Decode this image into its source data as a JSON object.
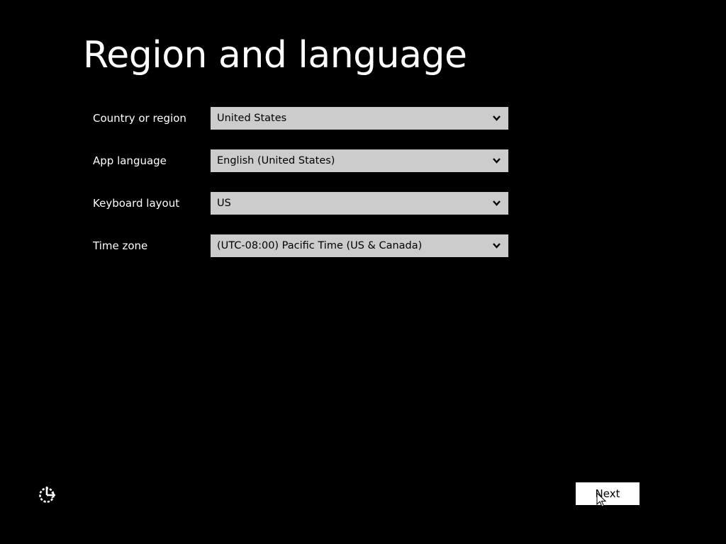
{
  "page": {
    "title": "Region and language"
  },
  "fields": [
    {
      "label": "Country or region",
      "value": "United States"
    },
    {
      "label": "App language",
      "value": "English (United States)"
    },
    {
      "label": "Keyboard layout",
      "value": "US"
    },
    {
      "label": "Time zone",
      "value": "(UTC-08:00) Pacific Time (US & Canada)"
    }
  ],
  "footer": {
    "next_label": "Next",
    "accessibility_icon": "ease-of-access-icon"
  },
  "colors": {
    "background": "#000000",
    "text": "#ffffff",
    "select_background": "#cccccc",
    "button_background": "#ffffff"
  }
}
